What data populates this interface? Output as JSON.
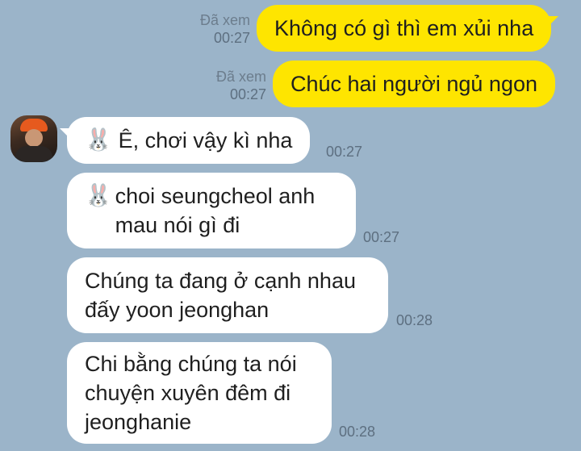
{
  "colors": {
    "background": "#9bb4c9",
    "outgoing_bubble": "#fee500",
    "incoming_bubble": "#ffffff"
  },
  "outgoing": [
    {
      "read": "Đã xem",
      "time": "00:27",
      "text": "Không có gì thì em xủi nha"
    },
    {
      "read": "Đã xem",
      "time": "00:27",
      "text": "Chúc hai người ngủ ngon"
    }
  ],
  "incoming": [
    {
      "emoji_icon": "rabbit-face-icon",
      "emoji": "🐰",
      "text": "Ê, chơi vậy kì nha",
      "time": "00:27"
    },
    {
      "emoji_icon": "rabbit-face-icon",
      "emoji": "🐰",
      "text": "choi seungcheol anh\nmau nói gì đi",
      "time": "00:27"
    },
    {
      "text": "Chúng ta đang ở cạnh nhau\nđấy yoon jeonghan",
      "time": "00:28"
    },
    {
      "text": "Chi bằng chúng ta nói\nchuyện xuyên đêm đi\njeonghanie",
      "time": "00:28"
    }
  ]
}
